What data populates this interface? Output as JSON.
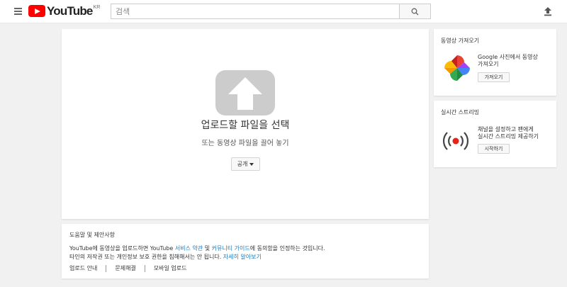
{
  "header": {
    "logo_text": "YouTube",
    "region": "KR",
    "search_placeholder": "검색"
  },
  "upload": {
    "title": "업로드할 파일을 선택",
    "subtitle": "또는 동영상 파일을 끌어 놓기",
    "privacy_label": "공개"
  },
  "help": {
    "title": "도움말 및 제안사항",
    "line1_prefix": "YouTube에 동영상을 업로드하면 YouTube ",
    "line1_link1": "서비스 약관",
    "line1_mid": " 및 ",
    "line1_link2": "커뮤니티 가이드",
    "line1_suffix": "에 동의함을 인정하는 것입니다.",
    "line2_prefix": "타인의 저작권 또는 개인정보 보호 권한을 침해해서는 안 됩니다. ",
    "line2_link": "자세히 알아보기",
    "links": [
      "업로드 안내",
      "문제해결",
      "모바일 업로드"
    ]
  },
  "import_panel": {
    "title": "동영상 가져오기",
    "text_line1": "Google 사진에서 동영상",
    "text_line2": "가져오기",
    "button": "가져오기"
  },
  "live_panel": {
    "title": "실시간 스트리밍",
    "text_line1": "채널을 설정하고 팬에게",
    "text_line2": "실시간 스트리밍 제공하기",
    "button": "시작하기"
  },
  "colors": {
    "brand_red": "#ff0000",
    "link_blue": "#167ac6",
    "upload_graphic": "#cccccc",
    "background": "#f1f1f1"
  },
  "icons": [
    "menu-icon",
    "youtube-play-icon",
    "search-icon",
    "upload-icon",
    "upload-arrow-icon",
    "google-photos-pinwheel-icon",
    "live-broadcast-icon",
    "caret-down-icon"
  ]
}
